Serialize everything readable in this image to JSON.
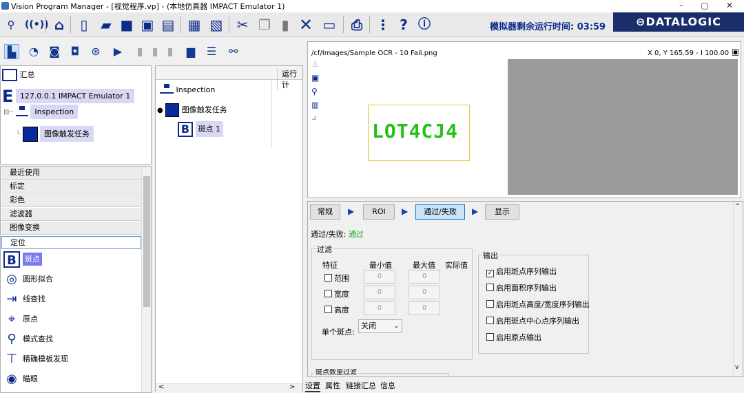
{
  "window": {
    "title": "Vision Program Manager - [视觉程序.vp] - (本地仿真器 IMPACT Emulator 1)",
    "minimize": "–",
    "maximize": "▢",
    "close": "✕"
  },
  "toolbar": {
    "timer_label": "模拟器剩余运行时间: 03:59",
    "brand": "⊖DATALOGIC",
    "icons": [
      "connect-icon",
      "wifi-icon",
      "home-icon",
      "new-file-icon",
      "open-icon",
      "folder-icon",
      "save-icon",
      "save-as-icon",
      "print-preview-icon",
      "copy-window-icon",
      "cut-icon",
      "copy-icon",
      "paste-icon",
      "delete-icon",
      "monitor-icon",
      "printer-icon",
      "more-icon",
      "help-icon",
      "info-icon"
    ]
  },
  "tree": {
    "summary": "汇总",
    "emulator": "127.0.0.1 IMPACT Emulator 1",
    "inspection": "Inspection",
    "trigger_task": "图像触发任务"
  },
  "middle": {
    "column_header": "运行计",
    "inspection": "Inspection",
    "trigger_task": "图像触发任务",
    "blob": "斑点 1"
  },
  "categories": [
    "最近使用",
    "标定",
    "彩色",
    "滤波器",
    "图像变换",
    "定位"
  ],
  "tools": [
    "斑点",
    "圆形拟合",
    "线查找",
    "原点",
    "模式查找",
    "精确模板发现",
    "瞄眼"
  ],
  "image": {
    "path": "/cf/Images/Sample OCR - 10 Fail.png",
    "coords": "X 0, Y 165.59 - I 100.00",
    "ocr_text": "LOT4CJ4"
  },
  "settings": {
    "tabs": [
      "常规",
      "ROI",
      "通过/失败",
      "显示"
    ],
    "passfail_label": "通过/失败:",
    "passfail_value": "通过",
    "filter_title": "过滤",
    "col_feature": "特征",
    "col_min": "最小值",
    "col_max": "最大值",
    "col_actual": "实际值",
    "rows": [
      {
        "label": "范围",
        "min": "0",
        "max": "0"
      },
      {
        "label": "宽度",
        "min": "0",
        "max": "0"
      },
      {
        "label": "高度",
        "min": "0",
        "max": "0"
      }
    ],
    "single_blob_label": "单个斑点:",
    "single_blob_value": "关闭",
    "output_title": "输出",
    "outputs": [
      {
        "label": "启用斑点序列输出",
        "checked": true
      },
      {
        "label": "启用面积序列输出",
        "checked": false
      },
      {
        "label": "启用斑点高度/宽度序列输出",
        "checked": false
      },
      {
        "label": "启用斑点中心点序列输出",
        "checked": false
      },
      {
        "label": "启用原点输出",
        "checked": false
      }
    ],
    "count_filter_title": "斑点数里过滤"
  },
  "bottom_tabs": [
    "设置",
    "属性",
    "链接汇总",
    "信息"
  ],
  "colors": {
    "accent": "#0b2a8c",
    "pass": "#1aa81a",
    "ocr": "#27c01b"
  }
}
